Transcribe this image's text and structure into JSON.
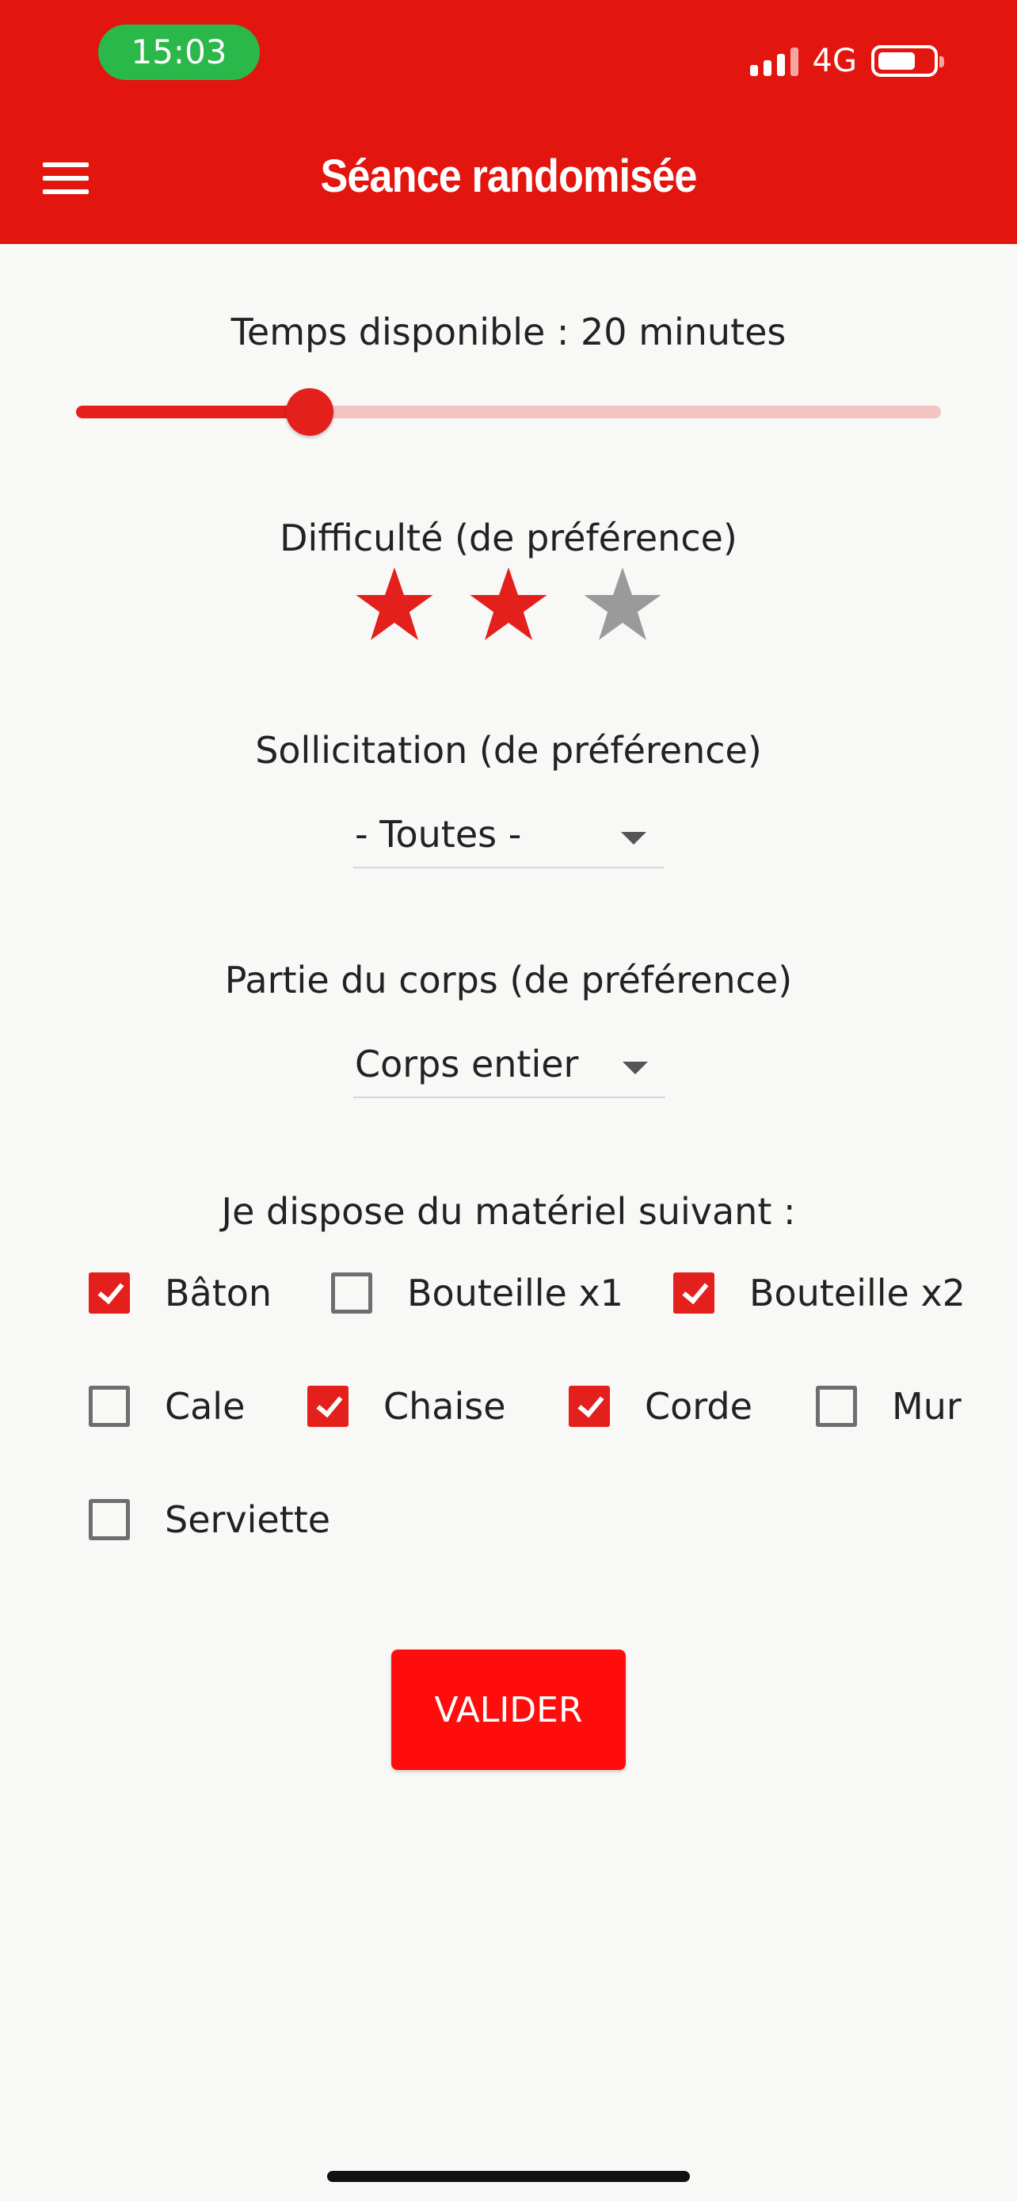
{
  "status_bar": {
    "time": "15:03",
    "network": "4G"
  },
  "app_bar": {
    "title": "Séance randomisée",
    "menu_icon": "hamburger-menu-icon"
  },
  "time": {
    "label": "Temps disponible : 20 minutes",
    "slider_fraction": 0.27
  },
  "difficulty": {
    "label": "Difficulté (de préférence)",
    "rating": 2,
    "max": 3,
    "filled_color": "#e3201b",
    "empty_color": "#9a9a9a"
  },
  "sollicitation": {
    "label": "Sollicitation (de préférence)",
    "value": "- Toutes -"
  },
  "body_part": {
    "label": "Partie du corps (de préférence)",
    "value": "Corps entier"
  },
  "equipment": {
    "label": "Je dispose du matériel suivant :",
    "items": [
      {
        "label": "Bâton",
        "checked": true
      },
      {
        "label": "Bouteille x1",
        "checked": false
      },
      {
        "label": "Bouteille x2",
        "checked": true
      },
      {
        "label": "Cale",
        "checked": false
      },
      {
        "label": "Chaise",
        "checked": true
      },
      {
        "label": "Corde",
        "checked": true
      },
      {
        "label": "Mur",
        "checked": false
      },
      {
        "label": "Serviette",
        "checked": false
      }
    ]
  },
  "submit_label": "VALIDER",
  "colors": {
    "accent": "#e3150f",
    "button": "#ff0d0d",
    "status_pill": "#2ab84a"
  }
}
